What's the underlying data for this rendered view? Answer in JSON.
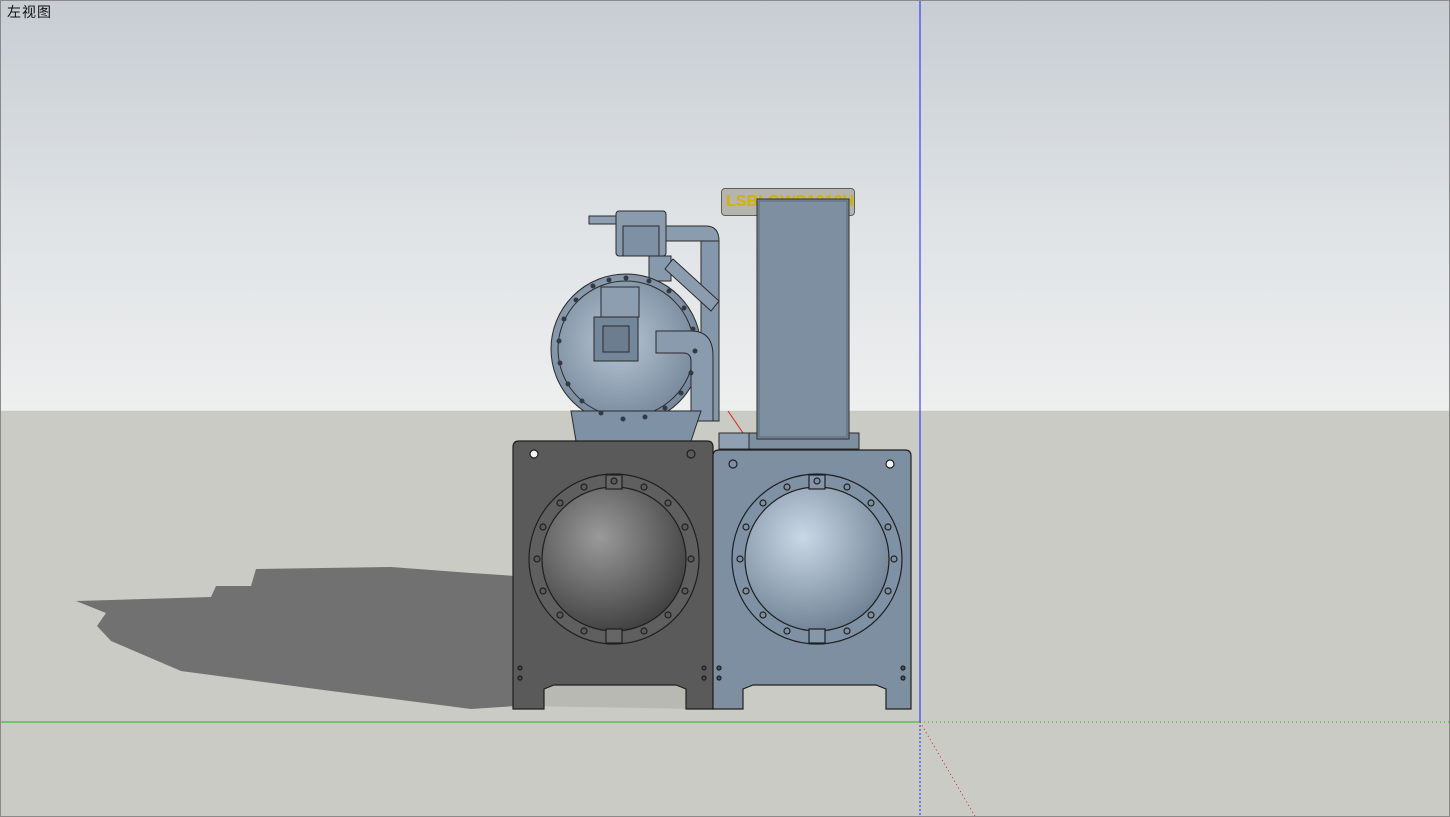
{
  "viewport": {
    "scene_label": "左视图",
    "model_tag": "LSBLGWD1010HDF"
  },
  "colors": {
    "sky": "#d4d9dd",
    "ground": "#cbcbc5",
    "shadow": "#6e6e6e",
    "unit_body": "#7c8e9f",
    "unit_dark_face": "#5b5b5b",
    "axis_blue": "#2020ff",
    "axis_green": "#18b818",
    "axis_red": "#d82020",
    "tag_text": "#d2b300"
  },
  "axes": [
    "blue-axis",
    "green-axis",
    "red-axis"
  ]
}
